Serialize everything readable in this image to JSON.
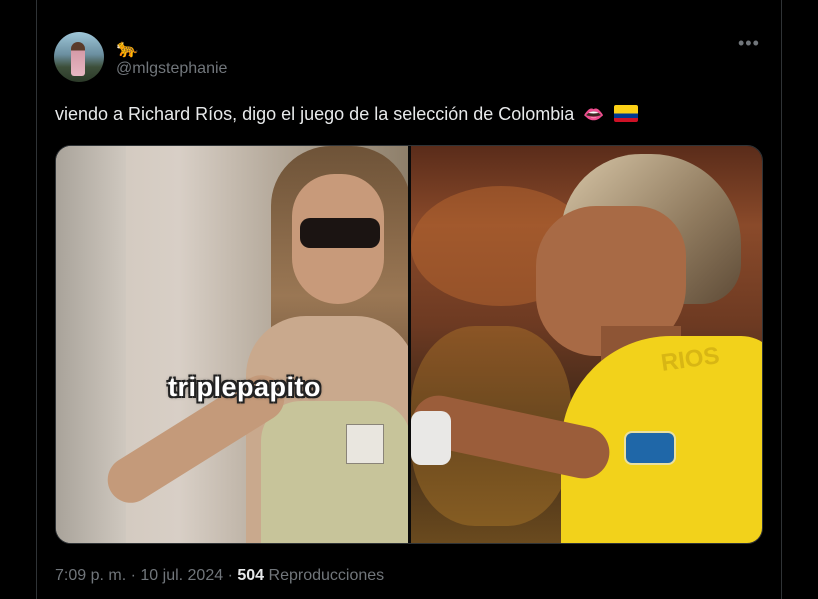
{
  "tweet": {
    "name_emoji": "🐆",
    "handle": "@mlgstephanie",
    "more_icon": "•••",
    "text": "viendo a Richard Ríos, digo el juego de la selección de Colombia",
    "text_emoji": "👄",
    "flag_icon": "colombia-flag",
    "media": {
      "left_caption": "triplepapito",
      "right_jersey_text": "RIOS"
    },
    "time": "7:09 p. m.",
    "sep1": "·",
    "date": "10 jul. 2024",
    "sep2": "·",
    "views_count": "504",
    "views_label": "Reproducciones"
  },
  "colors": {
    "background": "#000000",
    "text": "#e7e9ea",
    "muted": "#71767b",
    "border": "#2f3336"
  }
}
